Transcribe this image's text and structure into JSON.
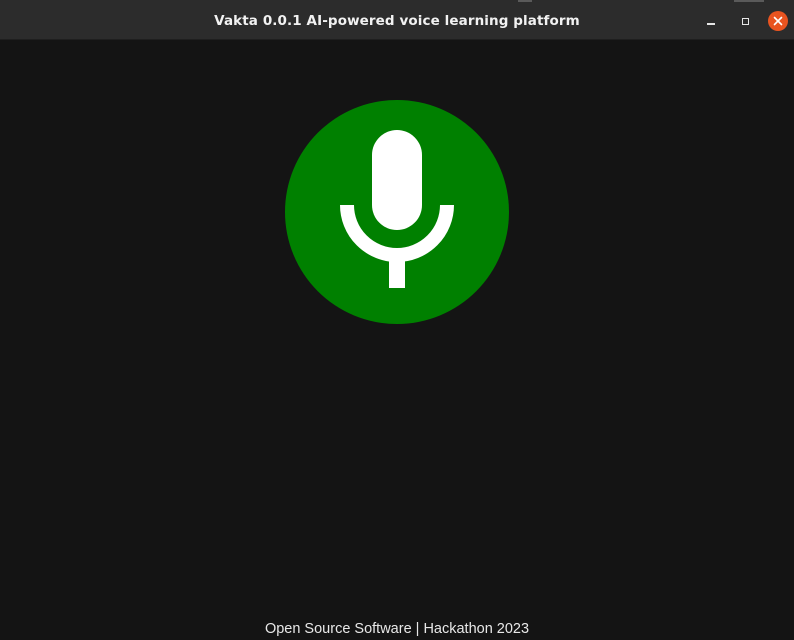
{
  "window": {
    "title": "Vakta 0.0.1 AI-powered voice learning platform",
    "controls": {
      "minimize_icon": "minimize-icon",
      "maximize_icon": "maximize-icon",
      "close_icon": "close-icon",
      "close_color": "#e95420"
    }
  },
  "main": {
    "mic_button": {
      "icon": "microphone-icon",
      "background_color": "#008000",
      "icon_color": "#ffffff"
    }
  },
  "footer": {
    "text": "Open Source Software | Hackathon 2023"
  },
  "colors": {
    "background": "#141414",
    "titlebar": "#2c2c2c"
  }
}
